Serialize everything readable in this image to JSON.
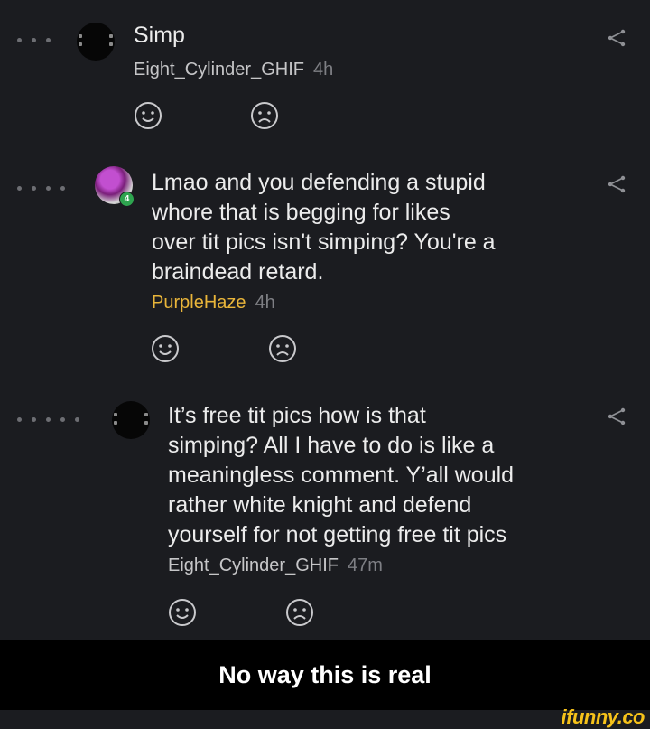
{
  "comments": [
    {
      "text": "Simp",
      "user": "Eight_Cylinder_GHIF",
      "time": "4h"
    },
    {
      "text": "Lmao and you defending a stupid\nwhore that is begging for likes\nover tit pics isn't simping? You're a\nbraindead retard.",
      "user": "PurpleHaze",
      "time": "4h",
      "badge": "4"
    },
    {
      "text": "It’s free tit pics how is that\nsimping? All I have to do is like a\nmeaningless comment. Y’all would\nrather white knight and defend\nyourself for not getting free tit pics",
      "user": "Eight_Cylinder_GHIF",
      "time": "47m"
    }
  ],
  "icons": {
    "like": "smile-icon",
    "dislike": "frown-icon",
    "share": "share-icon"
  },
  "colors": {
    "background": "#1b1c20",
    "username_gold": "#e9b53a",
    "watermark": "#f6c21a"
  },
  "caption": "No way this is real",
  "watermark": "ifunny.co"
}
